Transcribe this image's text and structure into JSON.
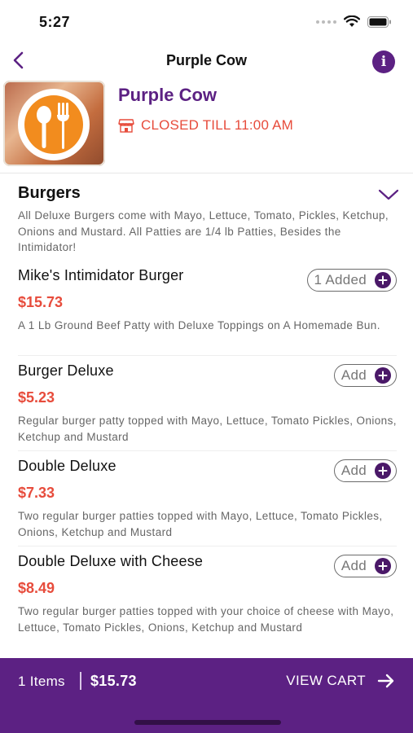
{
  "status_bar": {
    "time": "5:27"
  },
  "nav": {
    "title": "Purple Cow",
    "info_glyph": "i"
  },
  "restaurant": {
    "name": "Purple Cow",
    "status": "CLOSED TILL 11:00 AM",
    "logo_icon": "fork-spoon-icon"
  },
  "category": {
    "title": "Burgers",
    "description": "All Deluxe Burgers come with Mayo, Lettuce, Tomato, Pickles, Ketchup, Onions and Mustard. All Patties are 1/4 lb Patties, Besides the Intimidator!"
  },
  "items": [
    {
      "name": "Mike's Intimidator Burger",
      "price": "$15.73",
      "description": "A 1 Lb Ground Beef Patty with Deluxe Toppings on A Homemade Bun.",
      "button_label": "1 Added"
    },
    {
      "name": "Burger Deluxe",
      "price": "$5.23",
      "description": "Regular burger patty topped with Mayo, Lettuce, Tomato Pickles, Onions, Ketchup and Mustard",
      "button_label": "Add"
    },
    {
      "name": "Double Deluxe",
      "price": "$7.33",
      "description": "Two regular burger patties topped with Mayo, Lettuce, Tomato Pickles, Onions, Ketchup and Mustard",
      "button_label": "Add"
    },
    {
      "name": "Double Deluxe with Cheese",
      "price": "$8.49",
      "description": "Two regular burger patties topped with your choice of cheese with Mayo, Lettuce, Tomato Pickles, Onions, Ketchup and Mustard",
      "button_label": "Add"
    }
  ],
  "cart": {
    "count_label": "1 Items",
    "total": "$15.73",
    "view_label": "VIEW CART"
  },
  "colors": {
    "brand_purple": "#5c2183",
    "price_red": "#e74c3c",
    "closed_red": "#e74c3c"
  }
}
